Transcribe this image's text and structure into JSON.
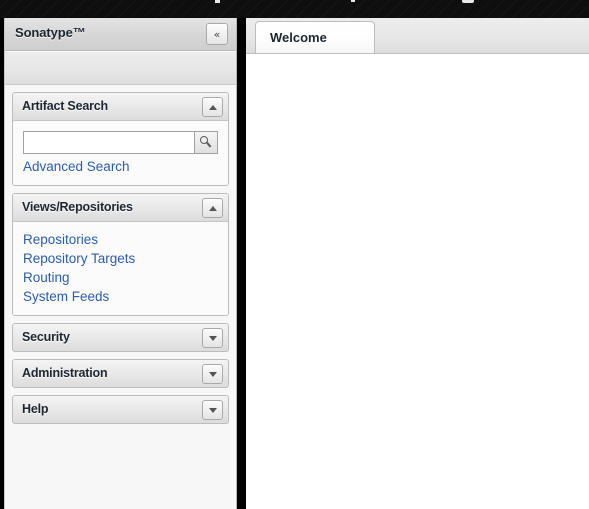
{
  "topbar": {
    "style": "dark-diagonal-stripes",
    "background_color": "#0e0e0e"
  },
  "sidebar": {
    "title": "Sonatype™",
    "collapse_button": {
      "icon": "double-chevron-left",
      "glyph": "«"
    },
    "panels": [
      {
        "id": "artifact-search",
        "title": "Artifact Search",
        "expanded": true,
        "toggle_icon": "chevron-up",
        "search": {
          "value": "",
          "placeholder": "",
          "button_icon": "search-icon"
        },
        "links": [
          {
            "label": "Advanced Search"
          }
        ]
      },
      {
        "id": "views-repositories",
        "title": "Views/Repositories",
        "expanded": true,
        "toggle_icon": "chevron-up",
        "links": [
          {
            "label": "Repositories"
          },
          {
            "label": "Repository Targets"
          },
          {
            "label": "Routing"
          },
          {
            "label": "System Feeds"
          }
        ]
      },
      {
        "id": "security",
        "title": "Security",
        "expanded": false,
        "toggle_icon": "chevron-down",
        "links": []
      },
      {
        "id": "administration",
        "title": "Administration",
        "expanded": false,
        "toggle_icon": "chevron-down",
        "links": []
      },
      {
        "id": "help",
        "title": "Help",
        "expanded": false,
        "toggle_icon": "chevron-down",
        "links": []
      }
    ]
  },
  "content": {
    "tabs": [
      {
        "label": "Welcome",
        "active": true
      }
    ],
    "panel_body": ""
  },
  "colors": {
    "link": "#2a5db0",
    "heading_text": "#1d2733",
    "panel_background": "#fbfbfb",
    "sidebar_background": "#f7f7f7",
    "gutter": "#000000",
    "content_background": "#ffffff"
  }
}
